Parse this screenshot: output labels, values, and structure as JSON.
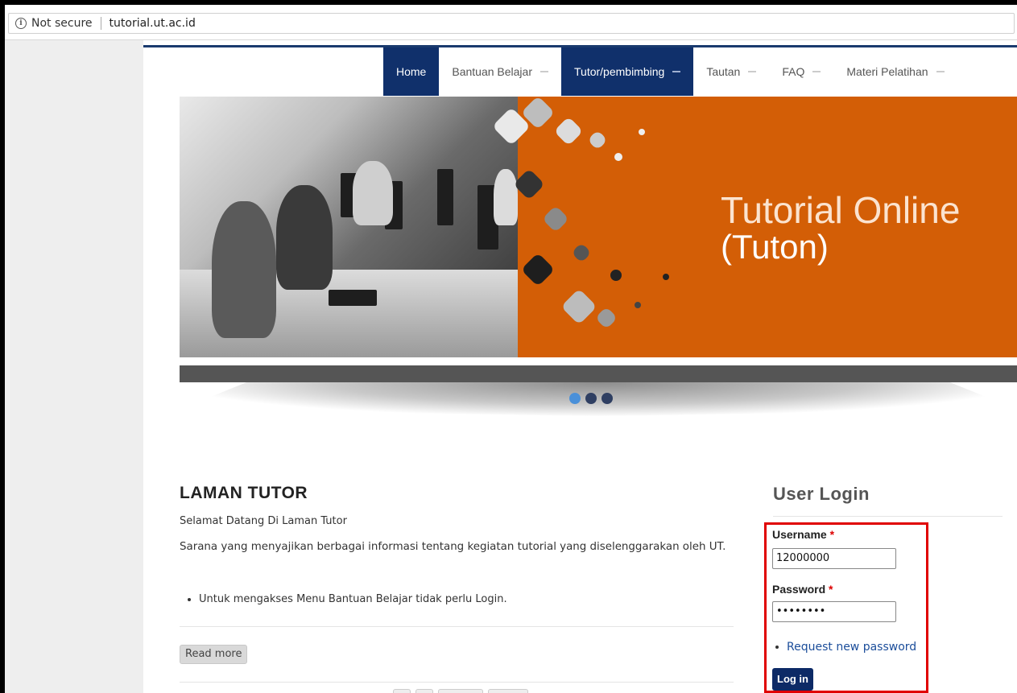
{
  "browser": {
    "security_label": "Not secure",
    "url": "tutorial.ut.ac.id",
    "info_icon_glyph": "i"
  },
  "nav": {
    "items": [
      {
        "label": "Home",
        "active": true
      },
      {
        "label": "Bantuan Belajar",
        "active": false
      },
      {
        "label": "Tutor/pembimbing",
        "active": true
      },
      {
        "label": "Tautan",
        "active": false
      },
      {
        "label": "FAQ",
        "active": false
      },
      {
        "label": "Materi Pelatihan",
        "active": false
      }
    ]
  },
  "banner": {
    "title": "Tutorial Online",
    "subtitle": "(Tuton)",
    "slide_index": 1,
    "slide_count": 3,
    "color": "#d35e06"
  },
  "content": {
    "title": "LAMAN TUTOR",
    "welcome": "Selamat Datang Di Laman Tutor",
    "description": "Sarana yang menyajikan berbagai informasi tentang kegiatan tutorial yang diselenggarakan oleh UT.",
    "bullet": "Untuk mengakses Menu Bantuan Belajar tidak perlu Login.",
    "read_more": "Read more"
  },
  "login": {
    "title": "User Login",
    "username_label": "Username",
    "username_value": "12000000",
    "password_label": "Password",
    "password_value": "••••••••",
    "required_mark": "*",
    "request_password": "Request new password",
    "button": "Log in"
  }
}
